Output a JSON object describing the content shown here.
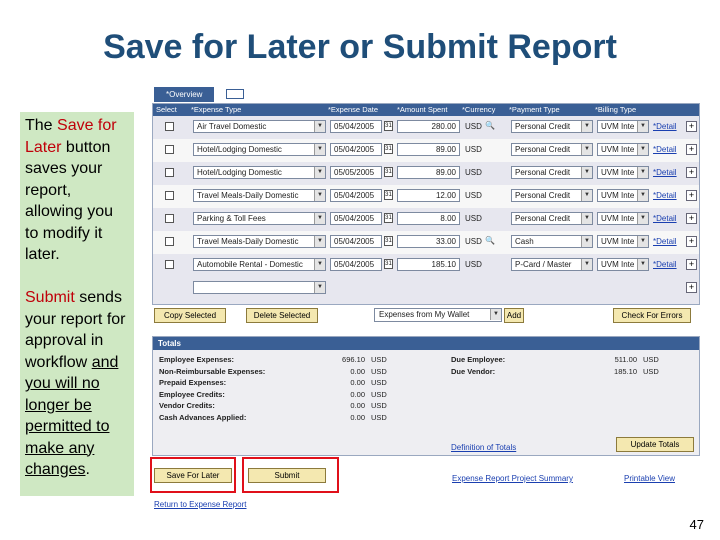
{
  "slide": {
    "title": "Save for Later or Submit Report",
    "page_number": "47",
    "note": {
      "p1_pre": "The ",
      "p1_red": "Save for Later",
      "p1_post": " button saves your report, allowing you to modify it later.",
      "p2_red": "Submit",
      "p2_mid": " sends your report for approval in workflow ",
      "p2_ul": "and you will no longer be permitted to make any changes",
      "p2_end": "."
    }
  },
  "app": {
    "tab_label": "*Overview",
    "columns": [
      "Select",
      "*Expense Type",
      "*Expense Date",
      "*Amount Spent",
      "*Currency",
      "*Payment Type",
      "*Billing Type"
    ],
    "rows": [
      {
        "type": "Air Travel Domestic",
        "date": "05/04/2005",
        "amount": "280.00",
        "currency": "USD",
        "payment": "Personal Credit",
        "billing": "UVM Inte",
        "detail": "*Detail"
      },
      {
        "type": "Hotel/Lodging Domestic",
        "date": "05/04/2005",
        "amount": "89.00",
        "currency": "USD",
        "payment": "Personal Credit",
        "billing": "UVM Inte",
        "detail": "*Detail"
      },
      {
        "type": "Hotel/Lodging Domestic",
        "date": "05/05/2005",
        "amount": "89.00",
        "currency": "USD",
        "payment": "Personal Credit",
        "billing": "UVM Inte",
        "detail": "*Detail"
      },
      {
        "type": "Travel Meals-Daily Domestic",
        "date": "05/04/2005",
        "amount": "12.00",
        "currency": "USD",
        "payment": "Personal Credit",
        "billing": "UVM Inte",
        "detail": "*Detail"
      },
      {
        "type": "Parking & Toll Fees",
        "date": "05/04/2005",
        "amount": "8.00",
        "currency": "USD",
        "payment": "Personal Credit",
        "billing": "UVM Inte",
        "detail": "*Detail"
      },
      {
        "type": "Travel Meals-Daily Domestic",
        "date": "05/04/2005",
        "amount": "33.00",
        "currency": "USD",
        "payment": "Cash",
        "billing": "UVM Inte",
        "detail": "*Detail"
      },
      {
        "type": "Automobile Rental - Domestic",
        "date": "05/04/2005",
        "amount": "185.10",
        "currency": "USD",
        "payment": "P-Card / Master",
        "billing": "UVM Inte",
        "detail": "*Detail"
      }
    ],
    "buttons": {
      "copy_selected": "Copy Selected",
      "delete_selected": "Delete Selected",
      "wallet_select": "Expenses from My Wallet",
      "add": "Add",
      "check_errors": "Check For Errors",
      "update_totals": "Update Totals",
      "save_for_later": "Save For Later",
      "submit": "Submit"
    },
    "totals": {
      "header": "Totals",
      "left": [
        {
          "label": "Employee Expenses:",
          "value": "696.10",
          "currency": "USD"
        },
        {
          "label": "Non-Reimbursable Expenses:",
          "value": "0.00",
          "currency": "USD"
        },
        {
          "label": "Prepaid Expenses:",
          "value": "0.00",
          "currency": "USD"
        },
        {
          "label": "Employee Credits:",
          "value": "0.00",
          "currency": "USD"
        },
        {
          "label": "Vendor Credits:",
          "value": "0.00",
          "currency": "USD"
        },
        {
          "label": "Cash Advances Applied:",
          "value": "0.00",
          "currency": "USD"
        }
      ],
      "right": [
        {
          "label": "Due Employee:",
          "value": "511.00",
          "currency": "USD"
        },
        {
          "label": "Due Vendor:",
          "value": "185.10",
          "currency": "USD"
        }
      ],
      "definition_link": "Definition of Totals"
    },
    "links": {
      "project_summary": "Expense Report Project Summary",
      "printable_view": "Printable View",
      "return": "Return to Expense Report"
    },
    "colors": {
      "header_blue": "#3a5f95",
      "highlight_red": "#e0101a",
      "note_green": "#cfe8c3",
      "note_red": "#c0000a"
    }
  }
}
